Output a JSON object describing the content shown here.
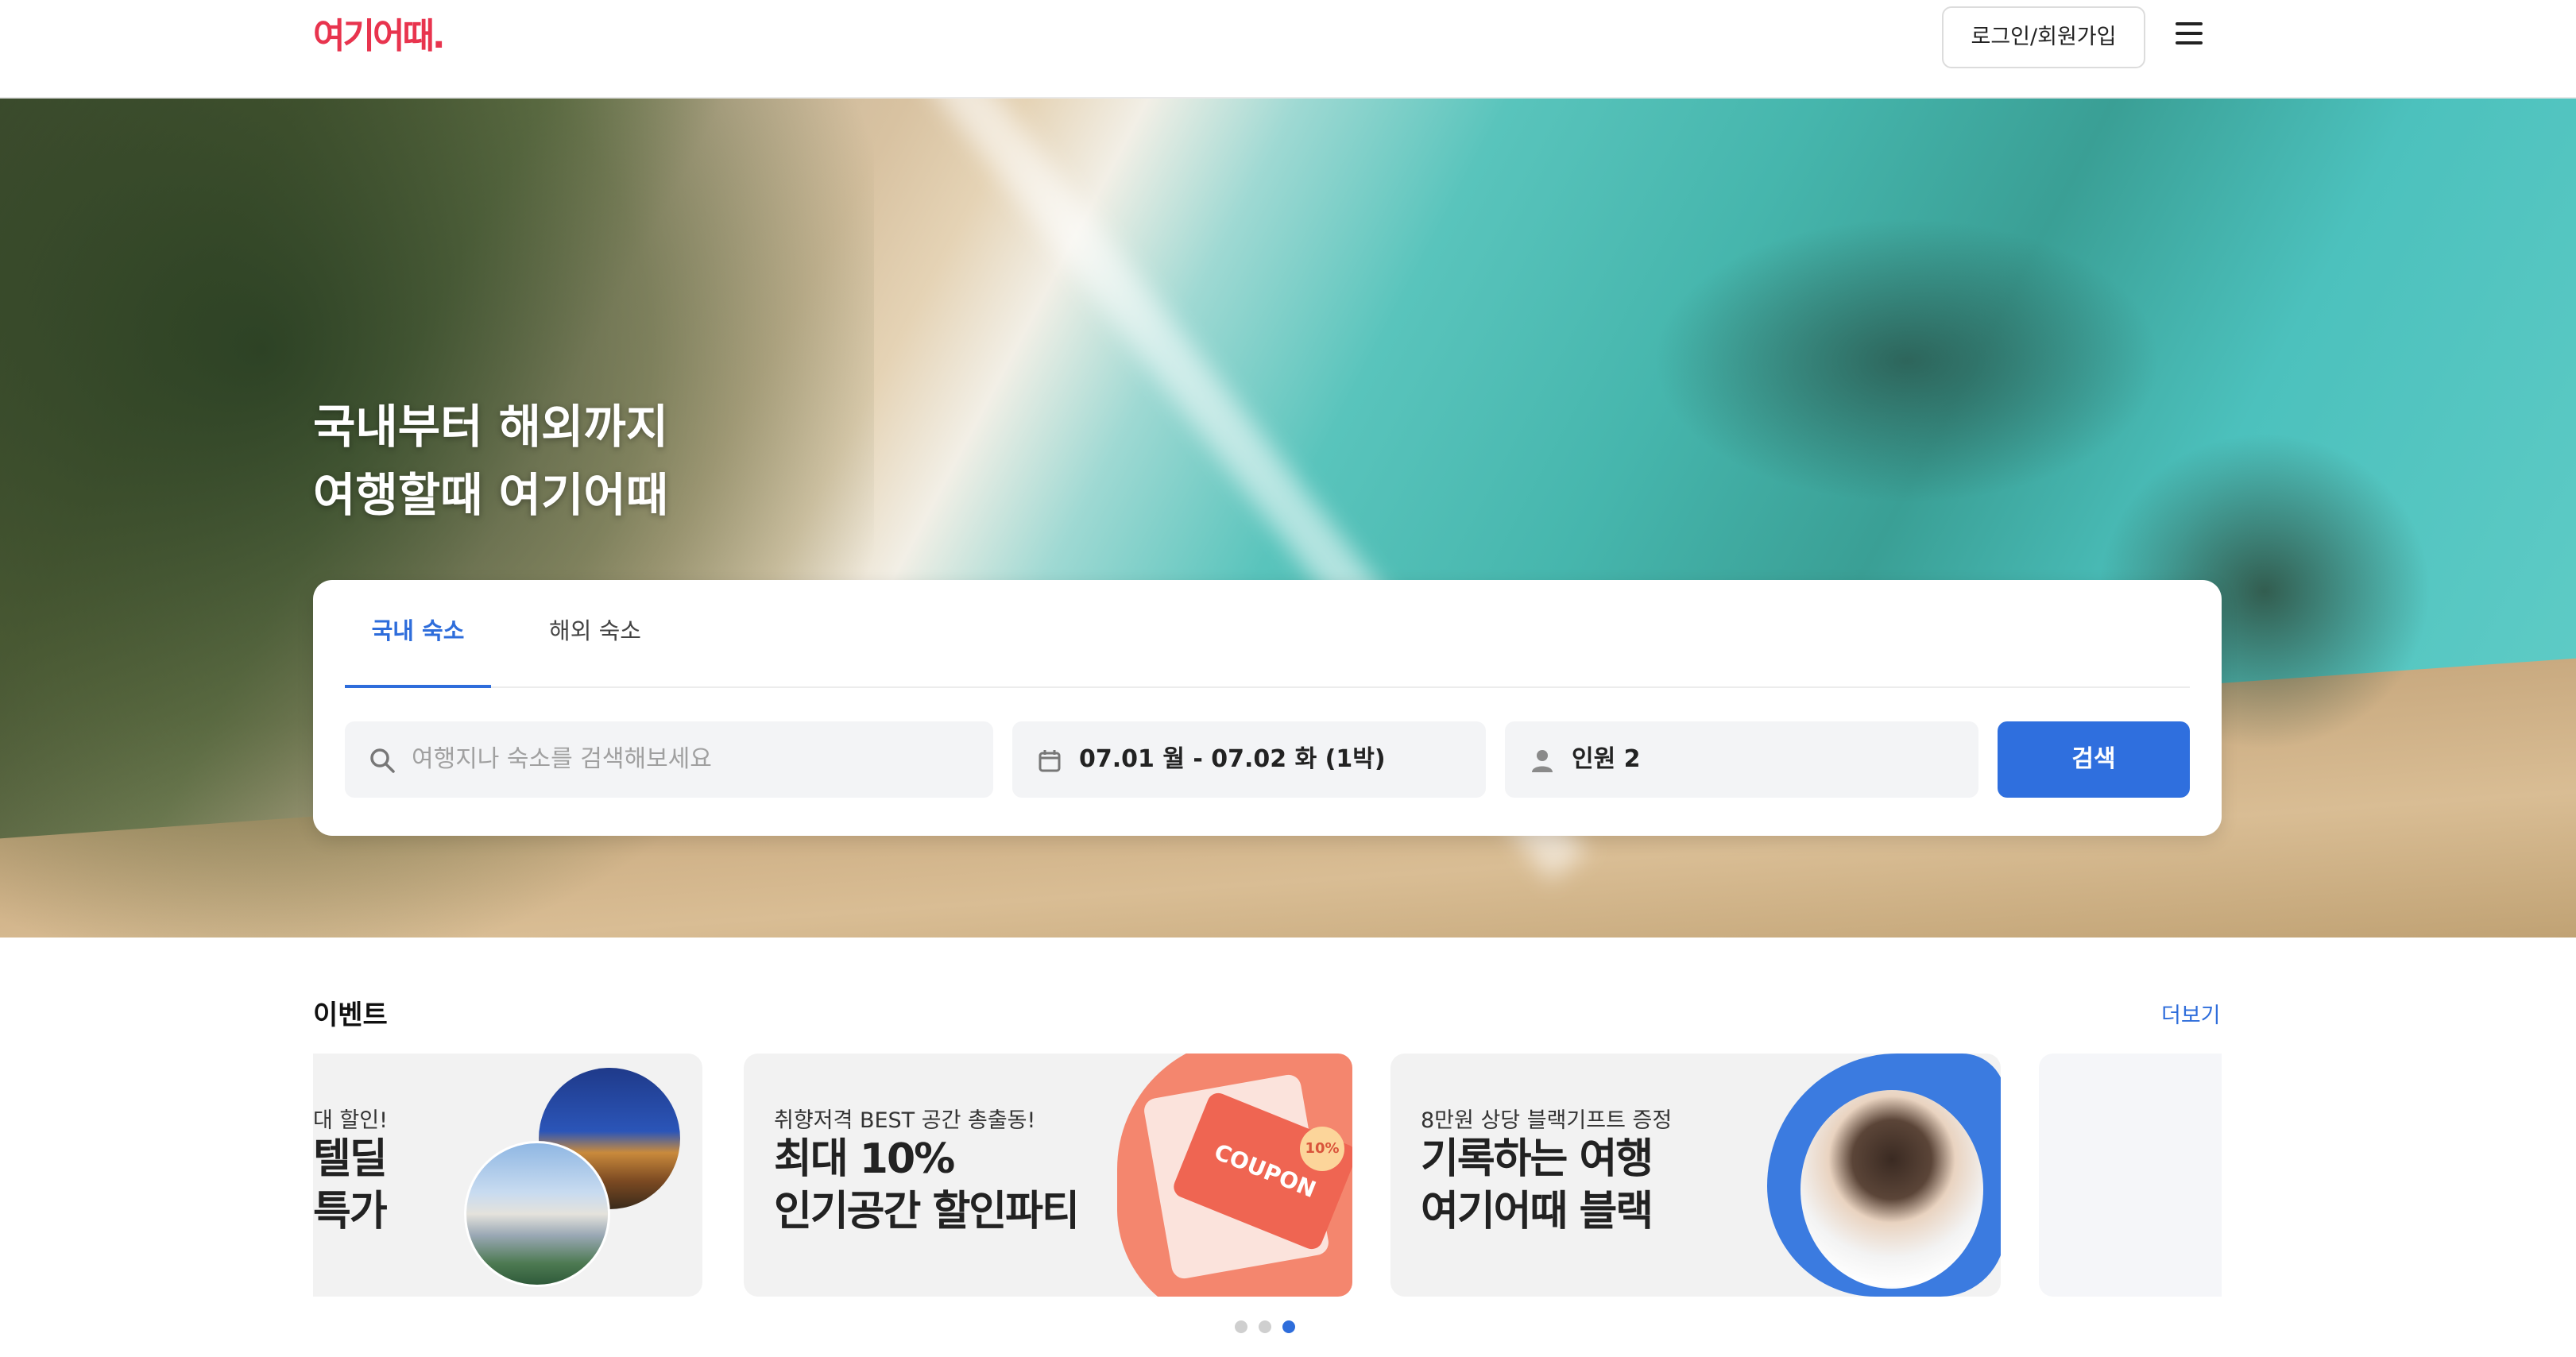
{
  "header": {
    "logo_text": "여기어때.",
    "login_label": "로그인/회원가입",
    "menu_icon": "hamburger-menu-icon"
  },
  "hero": {
    "title_line1": "국내부터 해외까지",
    "title_line2": "여행할때 여기어때"
  },
  "search": {
    "tabs": [
      {
        "label": "국내 숙소",
        "active": true
      },
      {
        "label": "해외 숙소",
        "active": false
      }
    ],
    "destination_placeholder": "여행지나 숙소를 검색해보세요",
    "date_value": "07.01 월 - 07.02 화 (1박)",
    "guests_value": "인원 2",
    "search_label": "검색",
    "accent_color": "#2f6fde"
  },
  "events": {
    "title": "이벤트",
    "more_label": "더보기",
    "cards": [
      {
        "sub": "대 할인!",
        "main_line1": "텔딜",
        "main_line2": "특가"
      },
      {
        "sub": "취향저격 BEST 공간 총출동!",
        "main_line1": "최대 10%",
        "main_line2": "인기공간 할인파티",
        "badge": "COUPON",
        "pct": "10%"
      },
      {
        "sub": "8만원 상당 블랙기프트 증정",
        "main_line1": "기록하는 여행",
        "main_line2": "여기어때 블랙"
      }
    ],
    "carousel_page": 3,
    "carousel_total": 3
  }
}
